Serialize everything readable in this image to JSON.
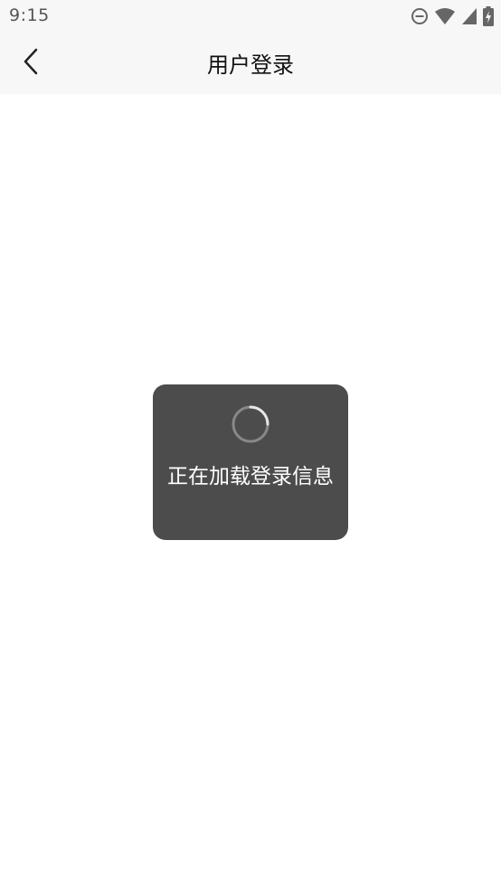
{
  "status_bar": {
    "time": "9:15",
    "icons": [
      "do-not-disturb-icon",
      "wifi-icon",
      "signal-icon",
      "battery-charging-icon"
    ]
  },
  "nav_bar": {
    "back_icon": "chevron-left-icon",
    "title": "用户登录"
  },
  "loading_toast": {
    "icon": "spinner-icon",
    "message": "正在加载登录信息"
  },
  "colors": {
    "bar_background": "#f7f7f7",
    "toast_background": "#4c4c4c",
    "toast_text": "#ffffff",
    "title_text": "#111111"
  }
}
